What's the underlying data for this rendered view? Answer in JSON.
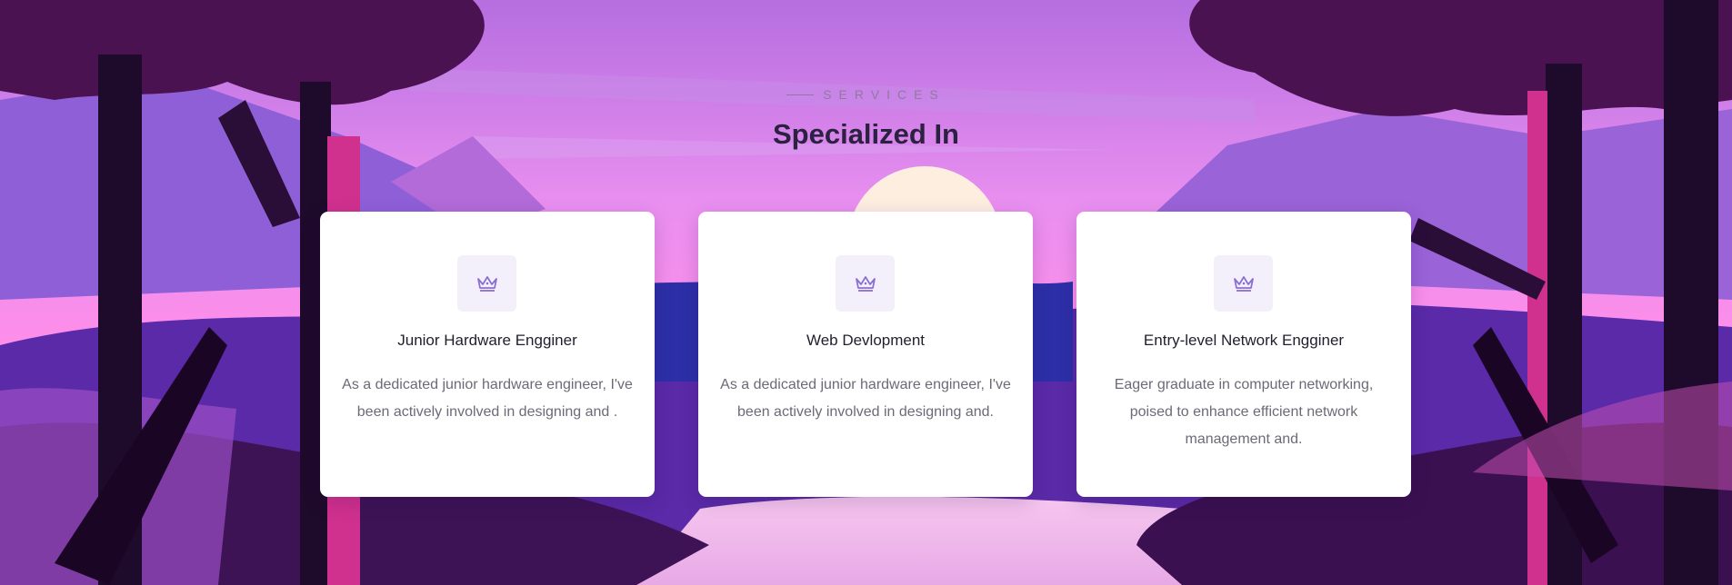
{
  "section": {
    "kicker": "SERVICES",
    "title": "Specialized In"
  },
  "cards": [
    {
      "icon": "crown-icon",
      "heading": "Junior Hardware Engginer",
      "description": "As a dedicated junior hardware engineer, I've been actively involved in designing and ."
    },
    {
      "icon": "crown-icon",
      "heading": "Web Devlopment",
      "description": "As a dedicated junior hardware engineer, I've been actively involved in designing and."
    },
    {
      "icon": "crown-icon",
      "heading": "Entry-level Network Engginer",
      "description": "Eager graduate in computer networking, poised to enhance efficient network management and."
    }
  ],
  "colors": {
    "accent": "#8b6fd0",
    "title": "#2b2140",
    "card_bg": "#ffffff",
    "icon_bg": "#f3f0fb"
  }
}
